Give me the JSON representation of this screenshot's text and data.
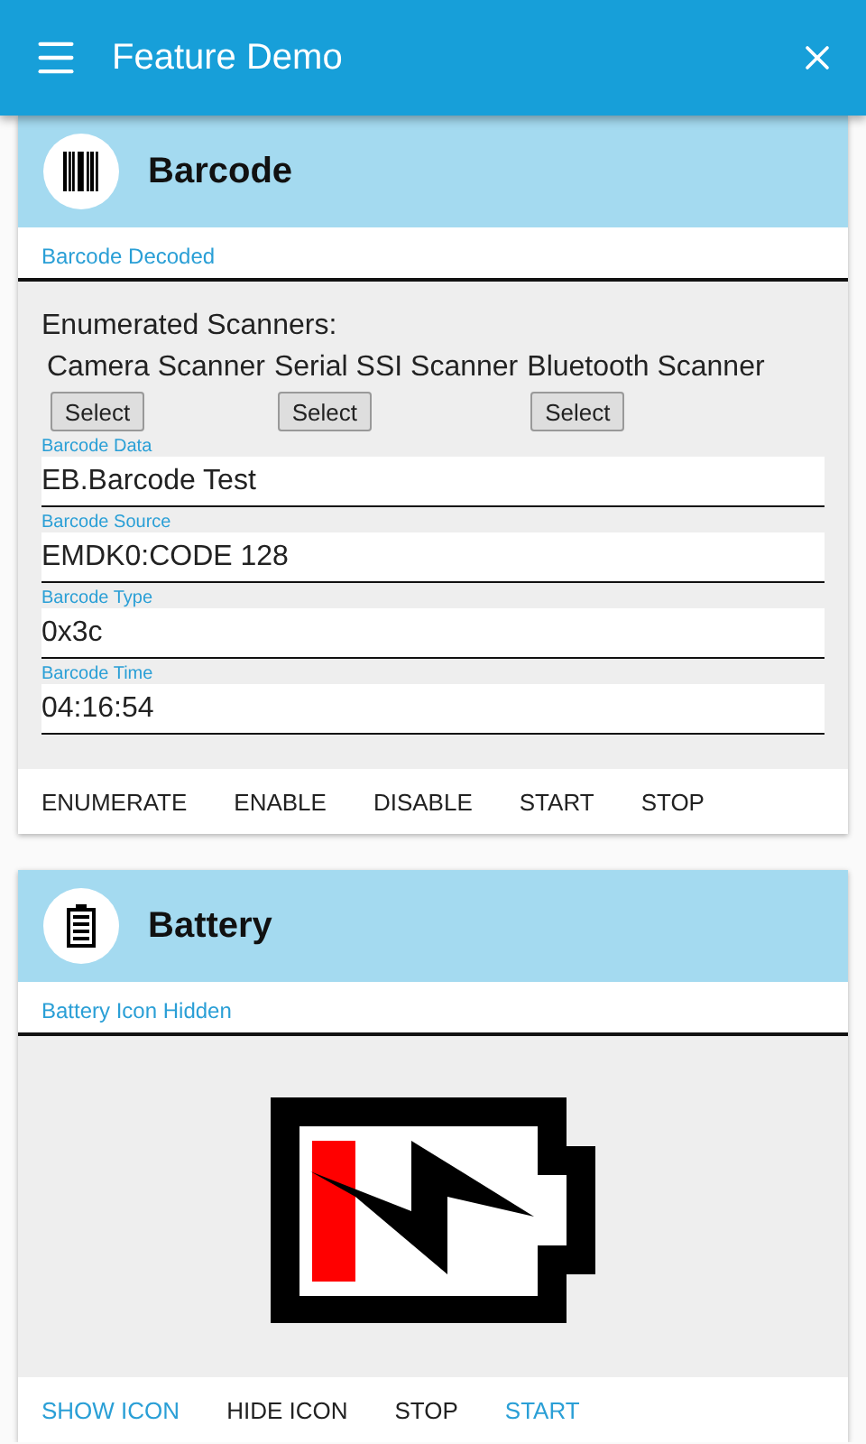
{
  "app_bar": {
    "title": "Feature Demo"
  },
  "barcode": {
    "title": "Barcode",
    "status": "Barcode Decoded",
    "scanners_label": "Enumerated Scanners:",
    "scanners": [
      {
        "name": "Camera Scanner",
        "button": "Select"
      },
      {
        "name": "Serial SSI Scanner",
        "button": "Select"
      },
      {
        "name": "Bluetooth Scanner",
        "button": "Select"
      }
    ],
    "fields": [
      {
        "label": "Barcode Data",
        "value": "EB.Barcode Test"
      },
      {
        "label": "Barcode Source",
        "value": "EMDK0:CODE 128"
      },
      {
        "label": "Barcode Type",
        "value": "0x3c"
      },
      {
        "label": "Barcode Time",
        "value": "04:16:54"
      }
    ],
    "actions": [
      {
        "label": "ENUMERATE",
        "color": "#212121"
      },
      {
        "label": "ENABLE",
        "color": "#212121"
      },
      {
        "label": "DISABLE",
        "color": "#212121"
      },
      {
        "label": "START",
        "color": "#212121"
      },
      {
        "label": "STOP",
        "color": "#212121"
      }
    ]
  },
  "battery": {
    "title": "Battery",
    "status": "Battery Icon Hidden",
    "actions": [
      {
        "label": "SHOW ICON",
        "color": "#2a9fd6"
      },
      {
        "label": "HIDE ICON",
        "color": "#212121"
      },
      {
        "label": "STOP",
        "color": "#212121"
      },
      {
        "label": "START",
        "color": "#2a9fd6"
      }
    ]
  }
}
